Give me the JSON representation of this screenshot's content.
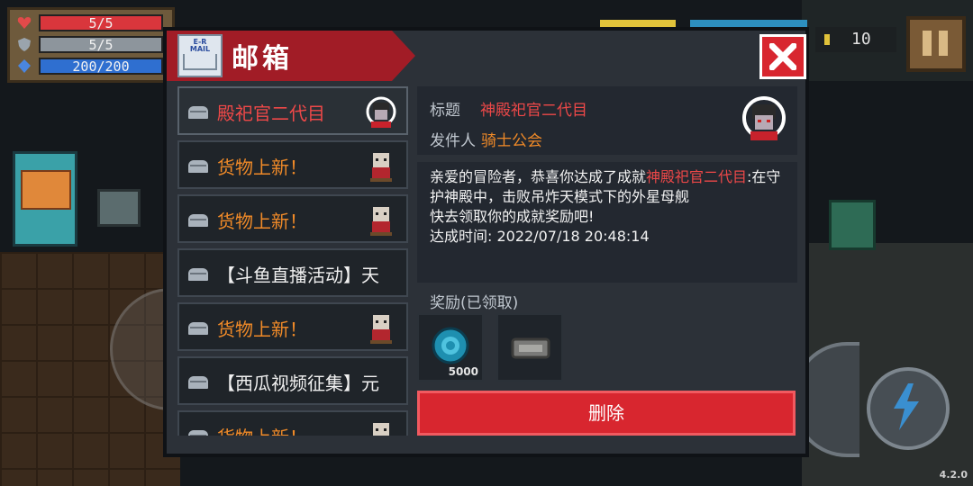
{
  "hud": {
    "health": "5/5",
    "armor": "5/5",
    "energy": "200/200",
    "health_fraction": 1.0,
    "armor_fraction": 1.0,
    "energy_fraction": 1.0,
    "coins": "10",
    "version": "4.2.0"
  },
  "mailbox": {
    "title": "邮箱",
    "icon_label_top": "E-R",
    "icon_label_bottom": "MAIL",
    "list": [
      {
        "subject": "殿祀官二代目",
        "color": "red",
        "avatar": "boss-avatar-icon"
      },
      {
        "subject": "货物上新！",
        "color": "orange",
        "avatar": "merchant-avatar-icon"
      },
      {
        "subject": "货物上新！",
        "color": "orange",
        "avatar": "merchant-avatar-icon"
      },
      {
        "subject": "【斗鱼直播活动】天",
        "color": "white",
        "avatar": ""
      },
      {
        "subject": "货物上新！",
        "color": "orange",
        "avatar": "merchant-avatar-icon"
      },
      {
        "subject": "【西瓜视频征集】元",
        "color": "white",
        "avatar": ""
      },
      {
        "subject": "货物上新！",
        "color": "orange",
        "avatar": "merchant-avatar-icon"
      }
    ],
    "detail": {
      "title_label": "标题",
      "title_value": "神殿祀官二代目",
      "sender_label": "发件人",
      "sender_value": "骑士公会",
      "body_part1": "亲爱的冒险者，恭喜你达成了成就",
      "body_highlight": "神殿祀官二代目",
      "body_part2": ":在守护神殿中，击败吊炸天模式下的外星母舰",
      "body_line3": "快去领取你的成就奖励吧!",
      "body_line4": "达成时间: 2022/07/18 20:48:14",
      "reward_label": "奖励(已领取)",
      "rewards": [
        {
          "icon": "gem-coin-icon",
          "qty": "5000"
        },
        {
          "icon": "ticket-icon",
          "qty": ""
        }
      ],
      "delete_label": "删除"
    }
  },
  "colors": {
    "accent_red": "#d8262f",
    "header_red": "#a11c26",
    "highlight_red": "#ee4848",
    "orange": "#f08a28",
    "panel_bg": "#2c3138"
  }
}
